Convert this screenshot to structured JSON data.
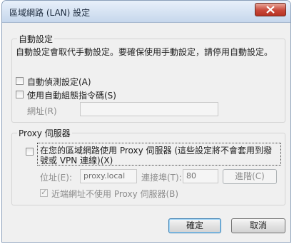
{
  "window": {
    "title": "區域網路 (LAN) 設定"
  },
  "auto_config": {
    "group_label": "自動設定",
    "description": "自動設定會取代手動設定。要確保使用手動設定，請停用自動設定。",
    "auto_detect_label": "自動偵測設定(A)",
    "auto_detect_checked": false,
    "script_label": "使用自動組態指令碼(S)",
    "script_checked": false,
    "address_label": "網址(R)",
    "address_value": ""
  },
  "proxy": {
    "group_label": "Proxy 伺服器",
    "use_proxy_label_line1": "在您的區域網路使用 Proxy 伺服器 (這些設定將不會套用到撥",
    "use_proxy_label_line2": "號或 VPN 連線)(X)",
    "use_proxy_checked": false,
    "address_label": "位址(E):",
    "address_value": "proxy.local",
    "port_label": "連接埠(T):",
    "port_value": "80",
    "advanced_button": "進階(C)",
    "bypass_label": "近端網址不使用 Proxy 伺服器(B)",
    "bypass_checked": true
  },
  "buttons": {
    "ok": "確定",
    "cancel": "取消"
  }
}
